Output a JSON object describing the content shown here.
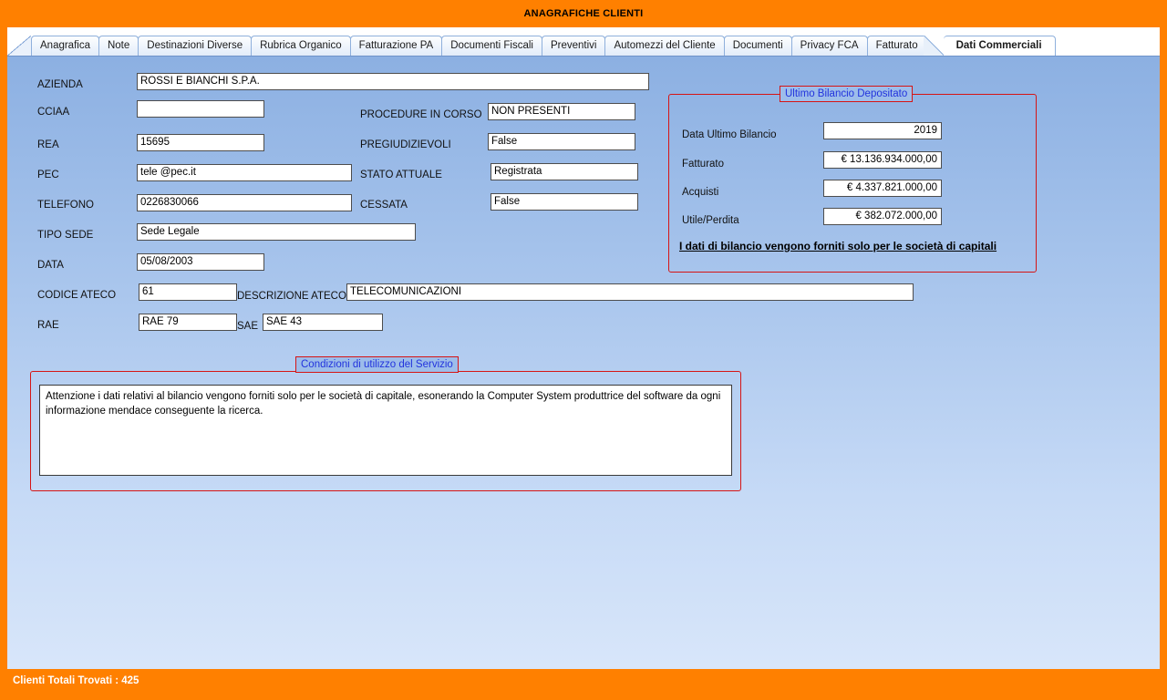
{
  "window": {
    "title": "ANAGRAFICHE CLIENTI",
    "accent_color": "#ff8000",
    "body_color": "#a7c4ec",
    "group_border_color": "#d61414",
    "group_title_color": "#2233dd"
  },
  "tabs": [
    {
      "label": "Anagrafica",
      "active": false
    },
    {
      "label": "Note",
      "active": false
    },
    {
      "label": "Destinazioni Diverse",
      "active": false
    },
    {
      "label": "Rubrica Organico",
      "active": false
    },
    {
      "label": "Fatturazione PA",
      "active": false
    },
    {
      "label": "Documenti Fiscali",
      "active": false
    },
    {
      "label": "Preventivi",
      "active": false
    },
    {
      "label": "Automezzi del Cliente",
      "active": false
    },
    {
      "label": "Documenti",
      "active": false
    },
    {
      "label": "Privacy FCA",
      "active": false
    },
    {
      "label": "Fatturato",
      "active": false
    },
    {
      "label": "Dati Commerciali",
      "active": true
    }
  ],
  "form": {
    "azienda": {
      "label": "AZIENDA",
      "value": "ROSSI E BIANCHI S.P.A."
    },
    "cciaa": {
      "label": "CCIAA",
      "value": ""
    },
    "rea": {
      "label": "REA",
      "value": "15695"
    },
    "pec": {
      "label": "PEC",
      "value": "tele @pec.it"
    },
    "telefono": {
      "label": "TELEFONO",
      "value": "0226830066"
    },
    "tipo_sede": {
      "label": "TIPO SEDE",
      "value": "Sede Legale"
    },
    "data": {
      "label": "DATA",
      "value": "05/08/2003"
    },
    "codice_ateco": {
      "label": "CODICE ATECO",
      "value": "61"
    },
    "descrizione_ateco": {
      "label": "DESCRIZIONE ATECO",
      "value": "TELECOMUNICAZIONI"
    },
    "rae": {
      "label": "RAE",
      "value": "RAE 79"
    },
    "sae": {
      "label": "SAE",
      "value": "SAE 43"
    },
    "procedure_in_corso": {
      "label": "PROCEDURE IN CORSO",
      "value": "NON PRESENTI"
    },
    "pregiudizievoli": {
      "label": "PREGIUDIZIEVOLI",
      "value": "False"
    },
    "stato_attuale": {
      "label": "STATO ATTUALE",
      "value": "Registrata"
    },
    "cessata": {
      "label": "CESSATA",
      "value": "False"
    }
  },
  "bilancio": {
    "title": "Ultimo Bilancio Depositato",
    "data_ultimo_bilancio": {
      "label": "Data Ultimo Bilancio",
      "value": "2019"
    },
    "fatturato": {
      "label": "Fatturato",
      "value": "€ 13.136.934.000,00"
    },
    "acquisti": {
      "label": "Acquisti",
      "value": "€ 4.337.821.000,00"
    },
    "utile_perdita": {
      "label": "Utile/Perdita",
      "value": "€ 382.072.000,00"
    },
    "note": "I dati di bilancio vengono forniti solo per le società di capitali"
  },
  "condizioni": {
    "title": "Condizioni di utilizzo del Servizio",
    "text": "Attenzione i dati relativi al bilancio vengono forniti solo per le società di capitale, esonerando la Computer System produttrice del software da ogni informazione mendace conseguente la ricerca."
  },
  "statusbar": {
    "text": "Clienti Totali Trovati : 425"
  }
}
